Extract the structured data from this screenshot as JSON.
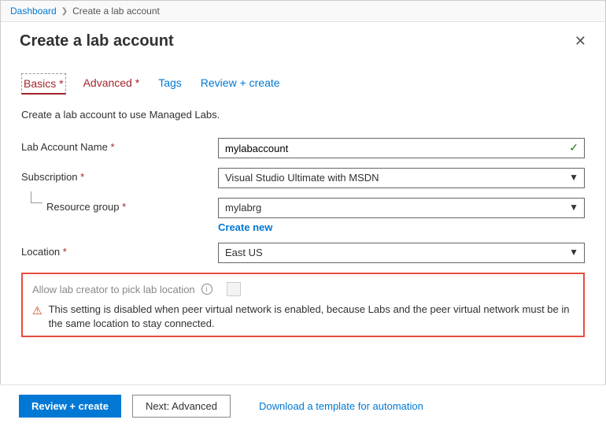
{
  "breadcrumb": {
    "root": "Dashboard",
    "current": "Create a lab account"
  },
  "header": {
    "title": "Create a lab account"
  },
  "tabs": [
    {
      "label": "Basics",
      "required": true,
      "active": true
    },
    {
      "label": "Advanced",
      "required": true,
      "active": false
    },
    {
      "label": "Tags",
      "required": false,
      "active": false
    },
    {
      "label": "Review + create",
      "required": false,
      "active": false
    }
  ],
  "intro": "Create a lab account to use Managed Labs.",
  "fields": {
    "name": {
      "label": "Lab Account Name",
      "value": "mylabaccount"
    },
    "subscription": {
      "label": "Subscription",
      "value": "Visual Studio Ultimate with MSDN"
    },
    "rg": {
      "label": "Resource group",
      "value": "mylabrg",
      "create_new": "Create new"
    },
    "location": {
      "label": "Location",
      "value": "East US"
    }
  },
  "highlight": {
    "setting_label": "Allow lab creator to pick lab location",
    "warning": "This setting is disabled when peer virtual network is enabled, because Labs and the peer virtual network must be in the same location to stay connected."
  },
  "footer": {
    "primary": "Review + create",
    "secondary": "Next: Advanced",
    "link": "Download a template for automation"
  }
}
